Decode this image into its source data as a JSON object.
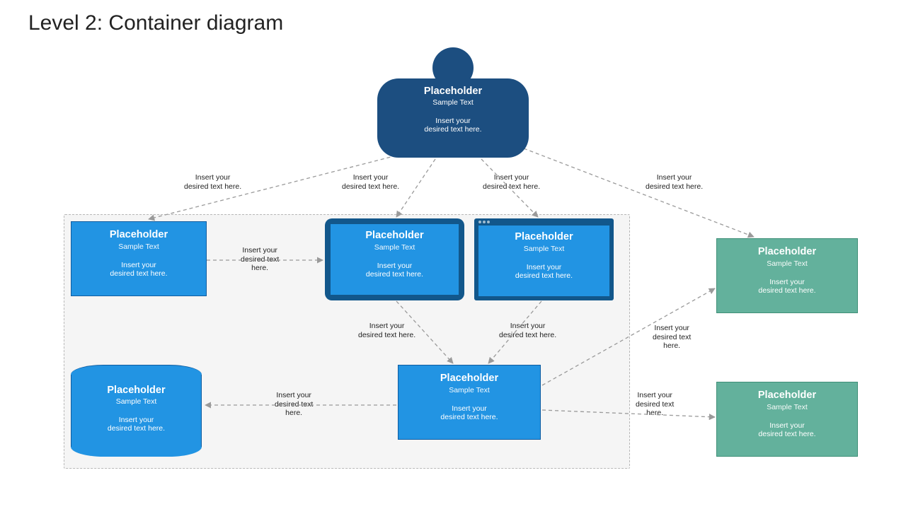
{
  "title": "Level 2: Container diagram",
  "person": {
    "title": "Placeholder",
    "sub": "Sample Text",
    "desc1": "Insert your",
    "desc2": "desired text here."
  },
  "edges": {
    "e1": {
      "l1": "Insert your",
      "l2": "desired text here."
    },
    "e2": {
      "l1": "Insert your",
      "l2": "desired text here."
    },
    "e3": {
      "l1": "Insert your",
      "l2": "desired text here."
    },
    "e4": {
      "l1": "Insert your",
      "l2": "desired text here."
    },
    "e5": {
      "l1": "Insert your",
      "l2": "desired text",
      "l3": "here."
    },
    "e6": {
      "l1": "Insert your",
      "l2": "desired text here."
    },
    "e7": {
      "l1": "Insert your",
      "l2": "desired text here."
    },
    "e8": {
      "l1": "Insert your",
      "l2": "desired text",
      "l3": "here."
    },
    "e9": {
      "l1": "Insert your",
      "l2": "desired text",
      "l3": "here."
    },
    "e10": {
      "l1": "Insert your",
      "l2": "desired text",
      "l3": "here."
    }
  },
  "containers": {
    "c1": {
      "title": "Placeholder",
      "sub": "Sample Text",
      "desc1": "Insert your",
      "desc2": "desired text here."
    },
    "c2": {
      "title": "Placeholder",
      "sub": "Sample Text",
      "desc1": "Insert your",
      "desc2": "desired text here."
    },
    "c3": {
      "title": "Placeholder",
      "sub": "Sample Text",
      "desc1": "Insert your",
      "desc2": "desired text here."
    },
    "api": {
      "title": "Placeholder",
      "sub": "Sample Text",
      "desc1": "Insert your",
      "desc2": "desired text here."
    },
    "db": {
      "title": "Placeholder",
      "sub": "Sample Text",
      "desc1": "Insert your",
      "desc2": "desired text here."
    },
    "ext1": {
      "title": "Placeholder",
      "sub": "Sample Text",
      "desc1": "Insert your",
      "desc2": "desired text here."
    },
    "ext2": {
      "title": "Placeholder",
      "sub": "Sample Text",
      "desc1": "Insert your",
      "desc2": "desired text here."
    }
  },
  "colors": {
    "personFill": "#1c4e80",
    "blueFill": "#2294e3",
    "blueBorder": "#0f5ca0",
    "greenFill": "#63b19c",
    "greenBorder": "#3f8f77",
    "boundaryBg": "#f5f5f5",
    "boundaryBorder": "#b8b8b8",
    "arrow": "#9a9a9a"
  }
}
